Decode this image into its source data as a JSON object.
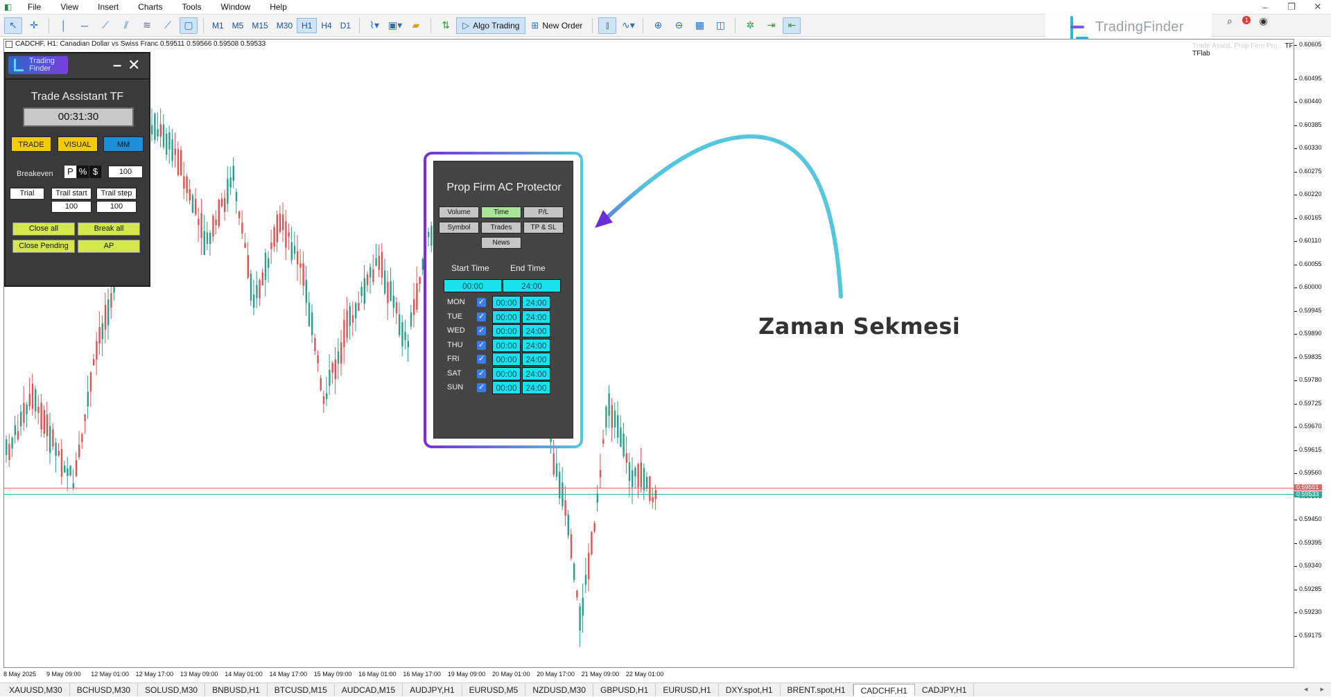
{
  "menu": {
    "items": [
      "File",
      "View",
      "Insert",
      "Charts",
      "Tools",
      "Window",
      "Help"
    ]
  },
  "toolbar": {
    "timeframes": [
      "M1",
      "M5",
      "M15",
      "M30",
      "H1",
      "H4",
      "D1"
    ],
    "active_timeframe": "H1",
    "algo_trading_label": "Algo Trading",
    "new_order_label": "New Order"
  },
  "logo": {
    "name": "TradingFinder"
  },
  "chart": {
    "header": "CADCHF, H1:  Canadian Dollar vs Swiss Franc  0.59511 0.59566 0.59508 0.59533",
    "right_header_faint": "Trade Assist. Prop Firm Pro...",
    "right_header": "TF MTS By TFlab",
    "bid_price": "0.59533",
    "ask_price": "0.59551",
    "price_ticks": [
      "0.60605",
      "0.60495",
      "0.60440",
      "0.60385",
      "0.60330",
      "0.60275",
      "0.60220",
      "0.60165",
      "0.60110",
      "0.60055",
      "0.60000",
      "0.59945",
      "0.59890",
      "0.59835",
      "0.59780",
      "0.59725",
      "0.59670",
      "0.59615",
      "0.59560",
      "0.59505",
      "0.59450",
      "0.59395",
      "0.59340",
      "0.59285",
      "0.59230",
      "0.59175"
    ],
    "time_ticks": [
      "8 May 2025",
      "9 May 09:00",
      "12 May 01:00",
      "12 May 17:00",
      "13 May 09:00",
      "14 May 01:00",
      "14 May 17:00",
      "15 May 09:00",
      "16 May 01:00",
      "16 May 17:00",
      "19 May 09:00",
      "20 May 01:00",
      "20 May 17:00",
      "21 May 09:00",
      "22 May 01:00"
    ],
    "colors": {
      "bull": "#2a9d8f",
      "bear": "#e05252"
    }
  },
  "trade_assistant": {
    "title": "Trade Assistant TF",
    "timer": "00:31:30",
    "logo_line1": "Trading",
    "logo_line2": "Finder",
    "mode_buttons": [
      "TRADE",
      "VISUAL",
      "MM"
    ],
    "breakeven_label": "Breakeven",
    "toggle_p": "P",
    "toggle_pct": "%",
    "toggle_usd": "$",
    "breakeven_value": "100",
    "trail_label": "Trial",
    "trail_start_label": "Trail start",
    "trail_step_label": "Trail step",
    "trail_start_value": "100",
    "trail_step_value": "100",
    "close_all_label": "Close all",
    "break_all_label": "Break all",
    "close_pending_label": "Close Pending",
    "ap_label": "AP"
  },
  "prop_firm": {
    "title": "Prop Firm AC Protector",
    "tabs": [
      "Volume",
      "Time",
      "P/L",
      "Symbol",
      "Trades",
      "TP & SL",
      "News"
    ],
    "active_tab": "Time",
    "start_time_label": "Start Time",
    "end_time_label": "End Time",
    "global_start": "00:00",
    "global_end": "24:00",
    "days": [
      {
        "day": "MON",
        "checked": true,
        "start": "00:00",
        "end": "24:00"
      },
      {
        "day": "TUE",
        "checked": true,
        "start": "00:00",
        "end": "24:00"
      },
      {
        "day": "WED",
        "checked": true,
        "start": "00:00",
        "end": "24:00"
      },
      {
        "day": "THU",
        "checked": true,
        "start": "00:00",
        "end": "24:00"
      },
      {
        "day": "FRI",
        "checked": true,
        "start": "00:00",
        "end": "24:00"
      },
      {
        "day": "SAT",
        "checked": true,
        "start": "00:00",
        "end": "24:00"
      },
      {
        "day": "SUN",
        "checked": true,
        "start": "00:00",
        "end": "24:00"
      }
    ]
  },
  "annotation": {
    "label": "Zaman Sekmesi"
  },
  "symbol_tabs": [
    "XAUUSD,M30",
    "BCHUSD,M30",
    "SOLUSD,M30",
    "BNBUSD,H1",
    "BTCUSD,M15",
    "AUDCAD,M15",
    "AUDJPY,H1",
    "EURUSD,M5",
    "NZDUSD,M30",
    "GBPUSD,H1",
    "EURUSD,H1",
    "DXY.spot,H1",
    "BRENT.spot,H1",
    "CADCHF,H1",
    "CADJPY,H1"
  ],
  "active_symbol_tab": "CADCHF,H1",
  "notifications": {
    "count": "1"
  }
}
